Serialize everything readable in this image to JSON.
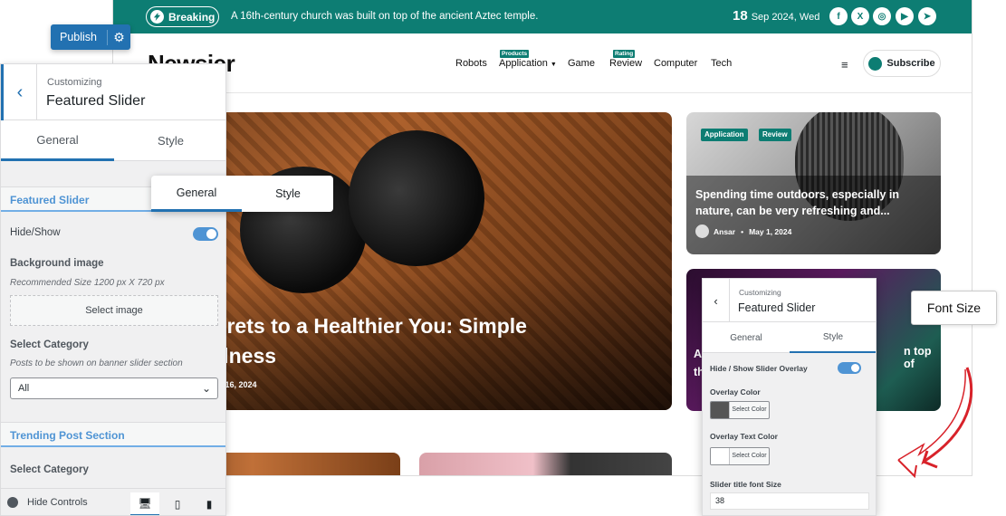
{
  "site": {
    "breaking_label": "Breaking",
    "breaking_text": "A 16th-century church was built on top of the ancient Aztec temple.",
    "date_day": "18",
    "date_rest": "Sep 2024, Wed",
    "social_icons": [
      "facebook-icon",
      "x-icon",
      "instagram-icon",
      "youtube-icon",
      "telegram-icon"
    ],
    "logo": "Newsier",
    "nav": [
      {
        "label": "Robots",
        "badge": ""
      },
      {
        "label": "Application",
        "badge": "Products"
      },
      {
        "label": "Game",
        "badge": ""
      },
      {
        "label": "Review",
        "badge": "Rating"
      },
      {
        "label": "Computer",
        "badge": ""
      },
      {
        "label": "Tech",
        "badge": ""
      }
    ],
    "hamburger": "≡",
    "subscribe_label": "Subscribe",
    "hero_title_line1": "king the Secrets to a Healthier You: Simple",
    "hero_title_line2": "or Daily Wellness",
    "hero_date": "ug 16, 2024",
    "card1": {
      "tags": [
        "Application",
        "Review"
      ],
      "title": "Spending time outdoors, especially in nature, can be very refreshing and...",
      "author": "Ansar",
      "date": "May 1, 2024"
    },
    "card2": {
      "text_left": "A",
      "text_left2": "th",
      "text_right": "n top of"
    },
    "accent_color": "#0d7d73"
  },
  "customizer": {
    "publish_label": "Publish",
    "customizing_label": "Customizing",
    "panel_title": "Featured Slider",
    "tabs": [
      "General",
      "Style"
    ],
    "section_featured": "Featured Slider",
    "hide_show_label": "Hide/Show",
    "hide_show_on": true,
    "bg_image_label": "Background image",
    "bg_image_note": "Recommended Size 1200 px X 720 px",
    "select_image_label": "Select image",
    "select_category_label": "Select Category",
    "select_category_note": "Posts to be shown on banner slider section",
    "category_value": "All",
    "section_trending": "Trending Post Section",
    "trending_category_label": "Select Category",
    "hide_controls_label": "Hide Controls",
    "device_icons": [
      "desktop-icon",
      "tablet-icon",
      "mobile-icon"
    ]
  },
  "float_tabs": [
    "General",
    "Style"
  ],
  "style_panel": {
    "customizing_label": "Customizing",
    "title": "Featured Slider",
    "tabs": [
      "General",
      "Style"
    ],
    "overlay_toggle_label": "Hide / Show Slider Overlay",
    "overlay_color_label": "Overlay Color",
    "overlay_color_value": "#555555",
    "overlay_text_color_label": "Overlay Text Color",
    "overlay_text_color_value": "#ffffff",
    "select_color_label": "Select Color",
    "font_size_label": "Slider title font Size",
    "font_size_value": "38"
  },
  "callout_font_size": "Font Size"
}
